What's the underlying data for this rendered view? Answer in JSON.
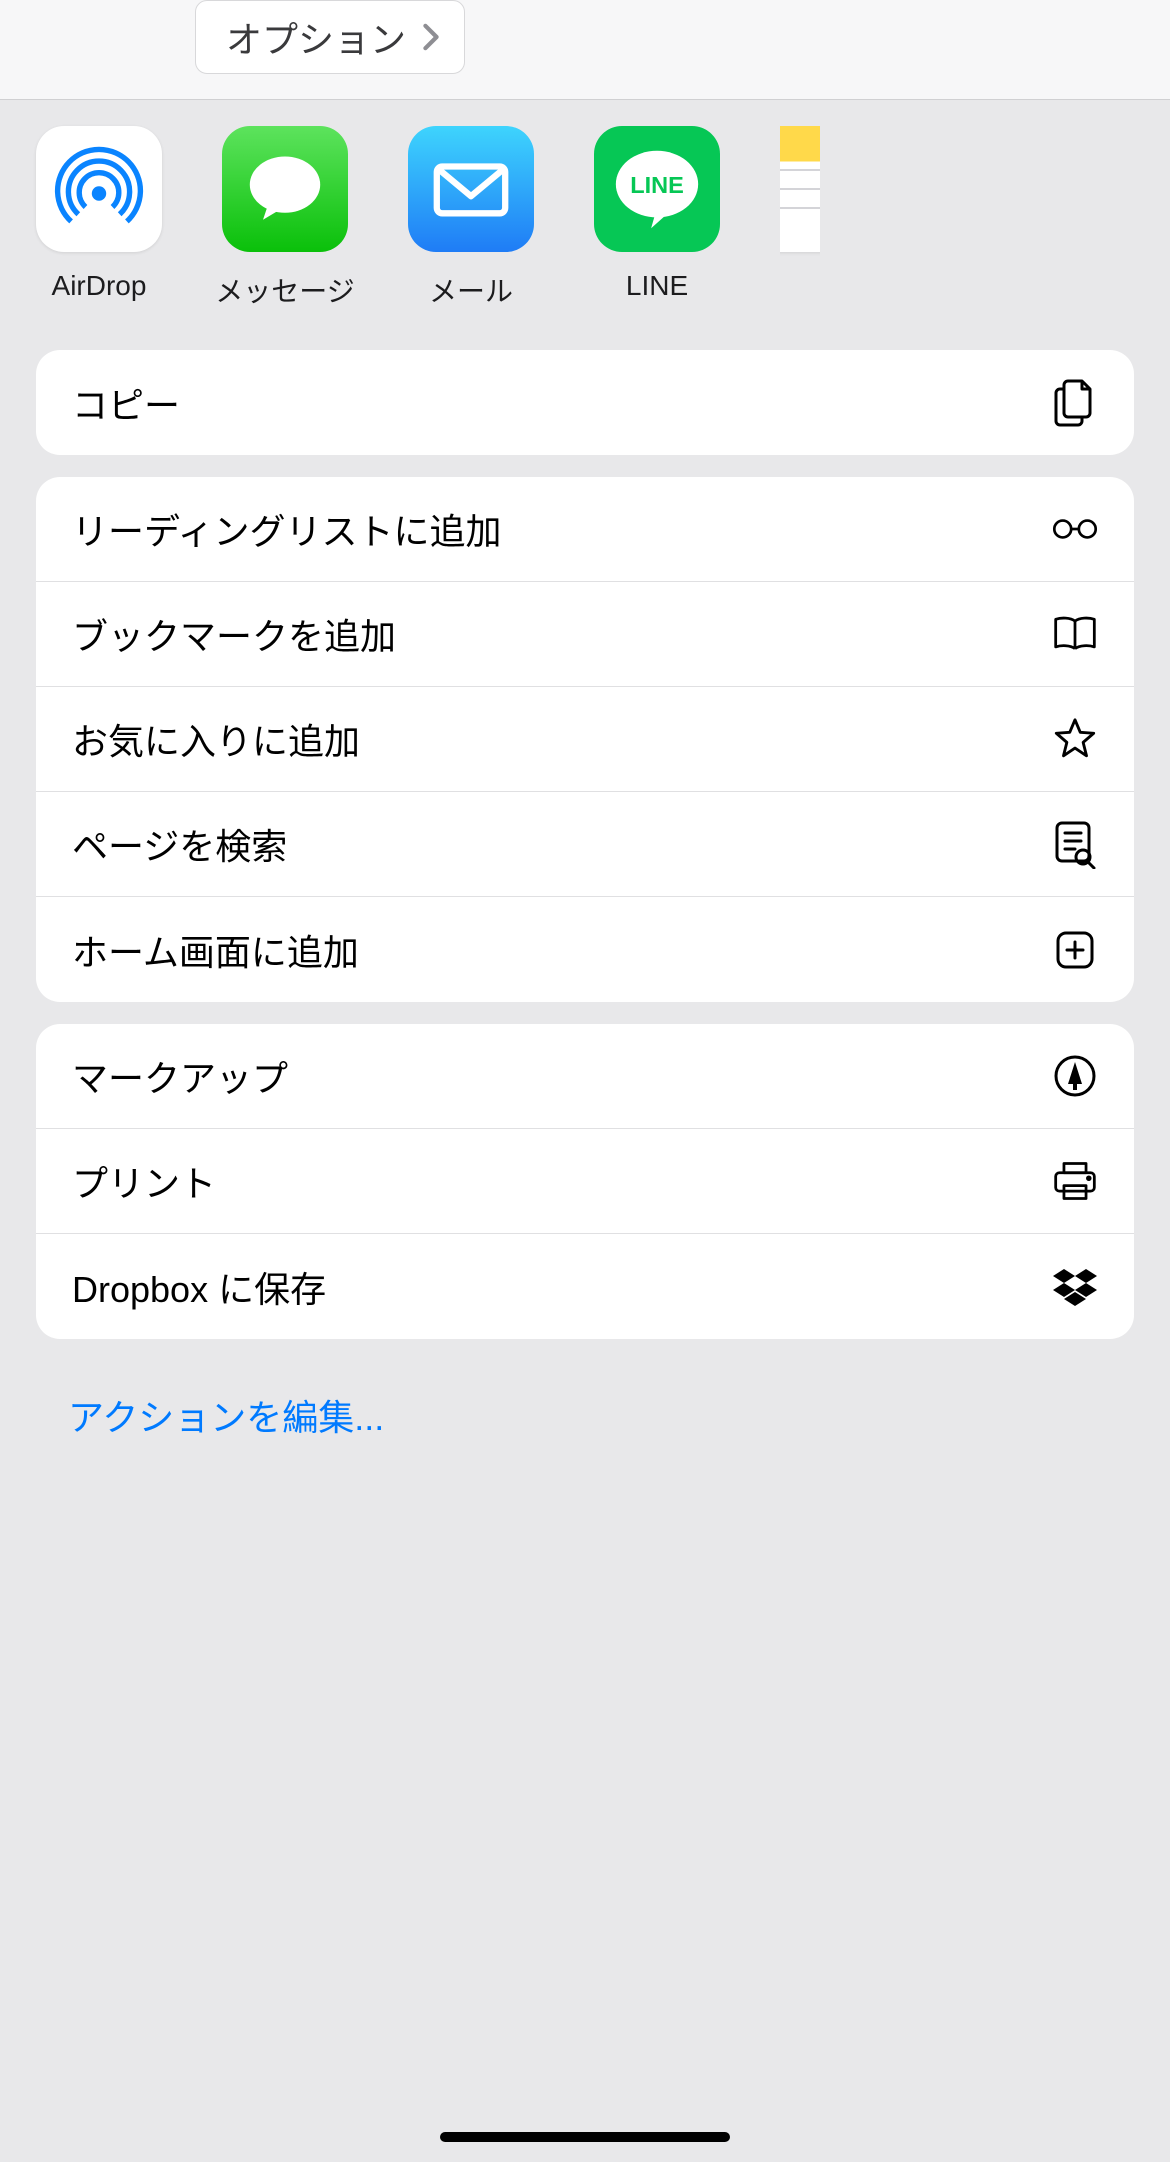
{
  "header": {
    "options_label": "オプション"
  },
  "apps": [
    {
      "id": "airdrop",
      "label": "AirDrop"
    },
    {
      "id": "messages",
      "label": "メッセージ"
    },
    {
      "id": "mail",
      "label": "メール"
    },
    {
      "id": "line",
      "label": "LINE"
    }
  ],
  "group1": {
    "copy": "コピー"
  },
  "group2": {
    "reading_list": "リーディングリストに追加",
    "bookmark": "ブックマークを追加",
    "favorites": "お気に入りに追加",
    "find": "ページを検索",
    "home_screen": "ホーム画面に追加"
  },
  "group3": {
    "markup": "マークアップ",
    "print": "プリント",
    "dropbox": "Dropbox に保存"
  },
  "edit_actions": "アクションを編集..."
}
